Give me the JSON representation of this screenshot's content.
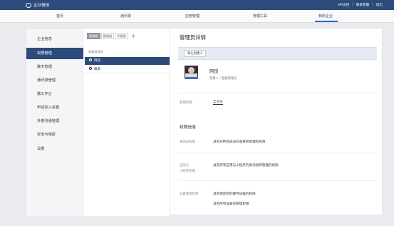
{
  "header": {
    "logo_text": "企业微信",
    "links": [
      "API文档",
      "联系客服",
      "退出"
    ]
  },
  "nav": {
    "items": [
      "首页",
      "通讯录",
      "应用管理",
      "管理工具",
      "我的企业"
    ],
    "active_index": 4
  },
  "sidebar": {
    "items": [
      "企业信息",
      "权限管理",
      "聊天管理",
      "通讯录管理",
      "微工作台",
      "申请加入设置",
      "外部沟通管理",
      "安全与保密",
      "设置"
    ],
    "active_index": 1
  },
  "middle": {
    "tabs": [
      "管理组",
      "管理组",
      "代管理"
    ],
    "active_tab": 0,
    "add_tab": "+",
    "group_label": "超级管理员",
    "rows": [
      "阿良",
      "敢者"
    ],
    "active_row": 0
  },
  "detail": {
    "title": "管理员详情",
    "transfer_button": "转让创建人",
    "user": {
      "name": "阿良",
      "role": "创建人 / 超级管理员"
    },
    "scope": {
      "label": "管理范围",
      "value": "全企业"
    },
    "permissions_title": "权限信息",
    "permissions": [
      {
        "label": "通讯录权限",
        "value": "具有对所有成员的查看和管理的权限"
      },
      {
        "label": "应用与\n小程序权限",
        "value": "具有所有应用与小程序的发消息和管理的权限"
      },
      {
        "label": "设备管理权限",
        "value": "具有绑定新的硬件设备的权限"
      },
      {
        "label": "",
        "value": "具有所有设备的管理权限"
      }
    ]
  },
  "colors": {
    "topbar": "#2c4a7a",
    "accent": "#2c6ac8",
    "active_item": "#2c4a7a",
    "toolbar_bg": "#e4ebf5"
  }
}
